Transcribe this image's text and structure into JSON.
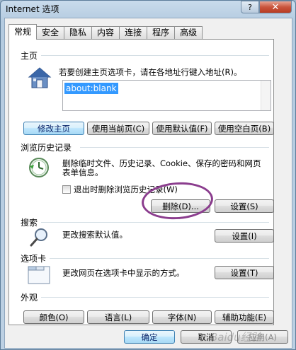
{
  "window": {
    "title": "Internet 选项",
    "help": "?",
    "close": "✕"
  },
  "tabs": [
    "常规",
    "安全",
    "隐私",
    "内容",
    "连接",
    "程序",
    "高级"
  ],
  "home": {
    "group_label": "主页",
    "description": "若要创建主页选项卡，请在各地址行键入地址(R)。",
    "url": "about:blank",
    "buttons": [
      "修改主页",
      "使用当前页(C)",
      "使用默认值(F)",
      "使用空白页(B)"
    ]
  },
  "history": {
    "group_label": "浏览历史记录",
    "description_line1": "删除临时文件、历史记录、Cookie、保存的密码和网页",
    "description_line2": "表单信息。",
    "checkbox_label": "退出时删除浏览历史记录(W)",
    "delete_button": "删除(D)...",
    "settings_button": "设置(S)"
  },
  "search": {
    "group_label": "搜索",
    "description": "更改搜索默认值。",
    "settings_button": "设置(I)"
  },
  "tabs_section": {
    "group_label": "选项卡",
    "description": "更改网页在选项卡中显示的方式。",
    "settings_button": "设置(T)"
  },
  "appearance": {
    "group_label": "外观",
    "buttons": [
      "颜色(O)",
      "语言(L)",
      "字体(N)",
      "辅助功能(E)"
    ]
  },
  "footer": {
    "ok": "确定",
    "cancel": "取消",
    "apply": "应用(A)"
  },
  "watermark": "Baidu经验"
}
